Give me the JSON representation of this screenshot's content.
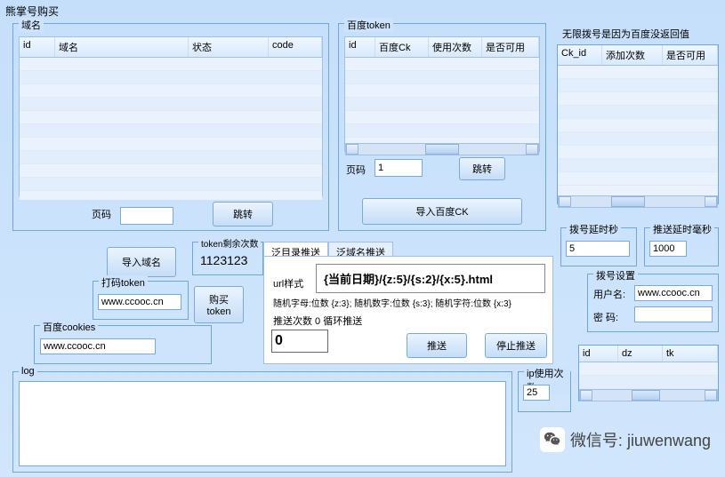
{
  "title": "熊掌号购买",
  "domain_group": {
    "label": "域名",
    "cols": [
      "id",
      "域名",
      "状态",
      "code"
    ],
    "page_label": "页码",
    "jump_label": "跳转"
  },
  "token_group": {
    "label": "百度token",
    "cols": [
      "id",
      "百度Ck",
      "使用次数",
      "是否可用"
    ],
    "page_label": "页码",
    "page_value": "1",
    "jump_label": "跳转",
    "import_label": "导入百度CK"
  },
  "right_msg": "无限拨号是因为百度没返回值",
  "ck_list": {
    "cols": [
      "Ck_id",
      "添加次数",
      "是否可用"
    ]
  },
  "import_domain": "导入域名",
  "token_remain": {
    "label": "token剩余次数",
    "value": "1123123"
  },
  "dama_token": {
    "label": "打码token",
    "value": "www.ccooc.cn"
  },
  "buy_token": "购买\ntoken",
  "baidu_cookies": {
    "label": "百度cookies",
    "value": "www.ccooc.cn"
  },
  "tabs": {
    "tab1": "泛目录推送",
    "tab2": "泛域名推送"
  },
  "url_style": {
    "label": "url样式",
    "pattern": "{当前日期}/{z:5}/{s:2}/{x:5}.html",
    "hint": "随机字母:位数 {z:3}; 随机数字:位数 {s:3}; 随机字符:位数 {x:3}",
    "push_count_label": "推送次数  0 循环推送",
    "push_value": "0",
    "push_btn": "推送",
    "stop_btn": "停止推送"
  },
  "dial_delay": {
    "label": "拨号延时秒",
    "value": "5"
  },
  "push_delay": {
    "label": "推送延时毫秒",
    "value": "1000"
  },
  "dial_settings": {
    "label": "拨号设置",
    "user_label": "用户名:",
    "user_value": "www.ccooc.cn",
    "pass_label": "密  码:"
  },
  "mini_list": {
    "cols": [
      "id",
      "dz",
      "tk"
    ]
  },
  "ip_usage": {
    "label": "ip使用次数",
    "value": "25"
  },
  "log": {
    "label": "log"
  },
  "watermark": "微信号: jiuwenwang"
}
